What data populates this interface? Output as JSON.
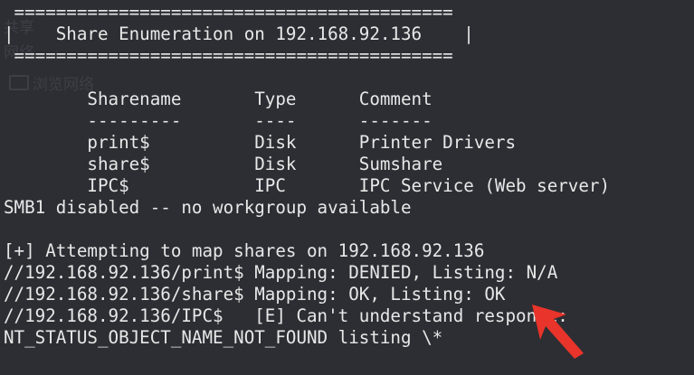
{
  "terminal": {
    "ghost_left": [
      "共享",
      "网络",
      "浏览网络"
    ],
    "lines": [
      " ==========================================",
      "|    Share Enumeration on 192.168.92.136    |",
      " ==========================================",
      "",
      "        Sharename       Type      Comment",
      "        ---------       ----      -------",
      "        print$          Disk      Printer Drivers",
      "        share$          Disk      Sumshare",
      "        IPC$            IPC       IPC Service (Web server)",
      "SMB1 disabled -- no workgroup available",
      "",
      "[+] Attempting to map shares on 192.168.92.136",
      "//192.168.92.136/print$ Mapping: DENIED, Listing: N/A",
      "//192.168.92.136/share$ Mapping: OK, Listing: OK",
      "//192.168.92.136/IPC$   [E] Can't understand response:",
      "NT_STATUS_OBJECT_NAME_NOT_FOUND listing \\*"
    ]
  },
  "annotation": {
    "arrow_color": "#e8342a"
  }
}
